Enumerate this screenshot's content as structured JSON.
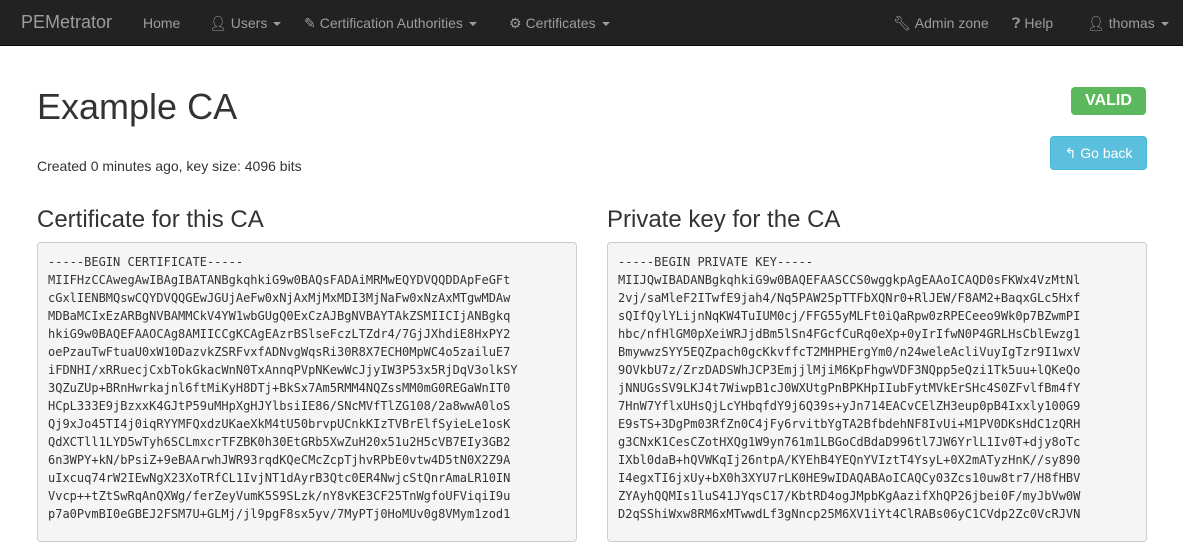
{
  "navbar": {
    "brand": "PEMetrator",
    "home": "Home",
    "users": "Users",
    "cas": "Certification Authorities",
    "certificates": "Certificates",
    "admin": "Admin zone",
    "help": "Help",
    "user": "thomas"
  },
  "page": {
    "title": "Example CA",
    "status": "VALID",
    "meta": "Created 0 minutes ago, key size: 4096 bits",
    "go_back": "Go back"
  },
  "certificate": {
    "heading": "Certificate for this CA",
    "lines": [
      "-----BEGIN CERTIFICATE-----",
      "MIIFHzCCAwegAwIBAgIBATANBgkqhkiG9w0BAQsFADAiMRMwEQYDVQQDDApFeGFt",
      "cGxlIENBMQswCQYDVQQGEwJGUjAeFw0xNjAxMjMxMDI3MjNaFw0xNzAxMTgwMDAw",
      "MDBaMCIxEzARBgNVBAMMCkV4YW1wbGUgQ0ExCzAJBgNVBAYTAkZSMIICIjANBgkq",
      "hkiG9w0BAQEFAAOCAg8AMIICCgKCAgEAzrBSlseFczLTZdr4/7GjJXhdiE8HxPY2",
      "oePzauTwFtuaU0xW10DazvkZSRFvxfADNvgWqsRi30R8X7ECH0MpWC4o5zailuE7",
      "iFDNHI/xRRuecjCxbTokGkacWnN0TxAnnqPVpNKewWcJjyIW3P53x5RjDqV3olkSY",
      "3QZuZUp+BRnHwrkajnl6ftMiKyH8DTj+BkSx7Am5RMM4NQZssMM0mG0REGaWnIT0",
      "HCpL333E9jBzxxK4GJtP59uMHpXgHJYlbsiIE86/SNcMVfTlZG108/2a8wwA0loS",
      "Qj9xJo45TI4j0iqRYYMFQxdzUKaeXkM4tU50brvpUCnkKIzTVBrElfSyieLe1osK",
      "QdXCTll1LYD5wTyh6SCLmxcrTFZBK0h30EtGRb5XwZuH20x51u2H5cVB7EIy3GB2",
      "6n3WPY+kN/bPsiZ+9eBAArwhJWR93rqdKQeCMcZcpTjhvRPbE0vtw4D5tN0X2Z9A",
      "uIxcuq74rW2IEwNgX23XoTRfCL1IvjNT1dAyrB3Qtc0ER4NwjcStQnrAmaLR10IN",
      "Vvcp++tZtSwRqAnQXWg/ferZeyVumK5S9SLzk/nY8vKE3CF25TnWgfoUFViqiI9u",
      "p7a0PvmBI0eGBEJ2FSM7U+GLMj/jl9pgF8sx5yv/7MyPTj0HoMUv0g8VMym1zod1"
    ]
  },
  "private_key": {
    "heading": "Private key for the CA",
    "lines": [
      "-----BEGIN PRIVATE KEY-----",
      "MIIJQwIBADANBgkqhkiG9w0BAQEFAASCCS0wggkpAgEAAoICAQD0sFKWx4VzMtNl",
      "2vj/saMleF2ITwfE9jah4/Nq5PAW25pTTFbXQNr0+RlJEW/F8AM2+BaqxGLc5Hxf",
      "sQIfQylYLijnNqKW4TuIUM0cj/FFG55yMLFt0iQaRpw0zRPECeeo9Wk0p7BZwmPI",
      "hbc/nfHlGM0pXeiWRJjdBm5lSn4FGcfCuRq0eXp+0yIrIfwN0P4GRLHsCblEwzg1",
      "BmywwzSYY5EQZpach0gcKkvffcT2MHPHErgYm0/n24weleAcliVuyIgTzr9I1wxV",
      "9OVkbU7z/ZrzDADSWhJCP3EmjjlMjiM6KpFhgwVDF3NQpp5eQzi1Tk5uu+lQKeQo",
      "jNNUGsSV9LKJ4t7WiwpB1cJ0WXUtgPnBPKHpIIubFytMVkErSHc4S0ZFvlfBm4fY",
      "7HnW7YflxUHsQjLcYHbqfdY9j6Q39s+yJn714EACvCElZH3eup0pB4Ixxly100G9",
      "E9sTS+3DgPm03RfZn0C4jFy6rvitbYgTA2BfbdehNF8IvUi+M1PV0DKsHdC1zQRH",
      "g3CNxK1CesCZotHXQg1W9yn761m1LBGoCdBdaD996tl7JW6YrlL1Iv0T+djy8oTc",
      "IXbl0daB+hQVWKqIj26ntpA/KYEhB4YEQnYVIztT4YsyL+0X2mATyzHnK//sy890",
      "I4egxTI6jxUy+bX0h3XYU7rLK0HE9wIDAQABAoICAQCy03Zcs10uw8tr7/H8fHBV",
      "ZYAyhQQMIs1luS41JYqsC17/KbtRD4ogJMpbKgAazifXhQP26jbei0F/myJbVw0W",
      "D2qSShiWxw8RM6xMTwwdLf3gNncp25M6XV1iYt4ClRABs06yC1CVdp2Zc0VcRJVN"
    ]
  }
}
